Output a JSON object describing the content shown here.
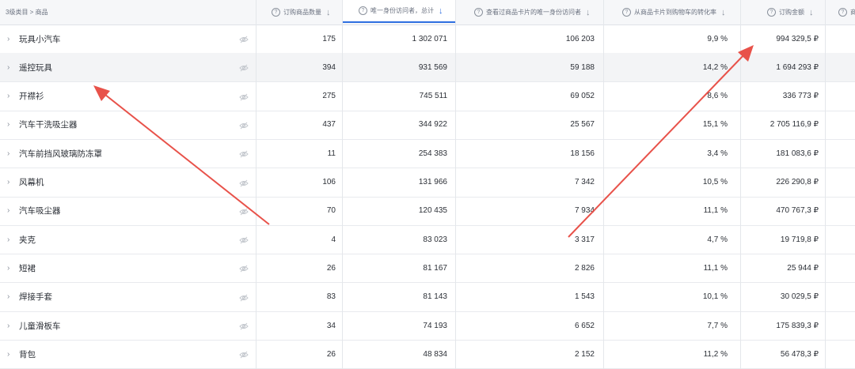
{
  "header": {
    "category_label": "3级类目 > 商品",
    "columns": [
      {
        "label": "订购商品数量",
        "help": "?"
      },
      {
        "label": "唯一身份访问者，总计",
        "help": "?"
      },
      {
        "label": "查看过商品卡片的唯一身份访问者",
        "help": "?"
      },
      {
        "label": "从商品卡片到购物车的转化率",
        "help": "?"
      },
      {
        "label": "订购金额",
        "help": "?"
      },
      {
        "label": "商",
        "help": "?"
      }
    ],
    "sort_arrow": "↓"
  },
  "rows": [
    {
      "name": "玩具小汽车",
      "qty": "175",
      "visitors": "1 302 071",
      "card_visitors": "106 203",
      "conversion": "9,9 %",
      "amount": "994 329,5 ₽"
    },
    {
      "name": "遥控玩具",
      "qty": "394",
      "visitors": "931 569",
      "card_visitors": "59 188",
      "conversion": "14,2 %",
      "amount": "1 694 293 ₽"
    },
    {
      "name": "开襟衫",
      "qty": "275",
      "visitors": "745 511",
      "card_visitors": "69 052",
      "conversion": "8,6 %",
      "amount": "336 773 ₽"
    },
    {
      "name": "汽车干洗吸尘器",
      "qty": "437",
      "visitors": "344 922",
      "card_visitors": "25 567",
      "conversion": "15,1 %",
      "amount": "2 705 116,9 ₽"
    },
    {
      "name": "汽车前挡风玻璃防冻罩",
      "qty": "11",
      "visitors": "254 383",
      "card_visitors": "18 156",
      "conversion": "3,4 %",
      "amount": "181 083,6 ₽"
    },
    {
      "name": "风幕机",
      "qty": "106",
      "visitors": "131 966",
      "card_visitors": "7 342",
      "conversion": "10,5 %",
      "amount": "226 290,8 ₽"
    },
    {
      "name": "汽车吸尘器",
      "qty": "70",
      "visitors": "120 435",
      "card_visitors": "7 934",
      "conversion": "11,1 %",
      "amount": "470 767,3 ₽"
    },
    {
      "name": "夹克",
      "qty": "4",
      "visitors": "83 023",
      "card_visitors": "3 317",
      "conversion": "4,7 %",
      "amount": "19 719,8 ₽"
    },
    {
      "name": "短裙",
      "qty": "26",
      "visitors": "81 167",
      "card_visitors": "2 826",
      "conversion": "11,1 %",
      "amount": "25 944 ₽"
    },
    {
      "name": "焊接手套",
      "qty": "83",
      "visitors": "81 143",
      "card_visitors": "1 543",
      "conversion": "10,1 %",
      "amount": "30 029,5 ₽"
    },
    {
      "name": "儿童滑板车",
      "qty": "34",
      "visitors": "74 193",
      "card_visitors": "6 652",
      "conversion": "7,7 %",
      "amount": "175 839,3 ₽"
    },
    {
      "name": "背包",
      "qty": "26",
      "visitors": "48 834",
      "card_visitors": "2 152",
      "conversion": "11,2 %",
      "amount": "56 478,3 ₽"
    }
  ],
  "icons": {
    "expand": "chevron-right-icon",
    "visibility": "eye-off-icon",
    "help": "question-circle-icon"
  },
  "colors": {
    "accent": "#2f6fe0",
    "annotation_arrow": "#e8524a",
    "highlight_row": "#f3f4f6"
  }
}
